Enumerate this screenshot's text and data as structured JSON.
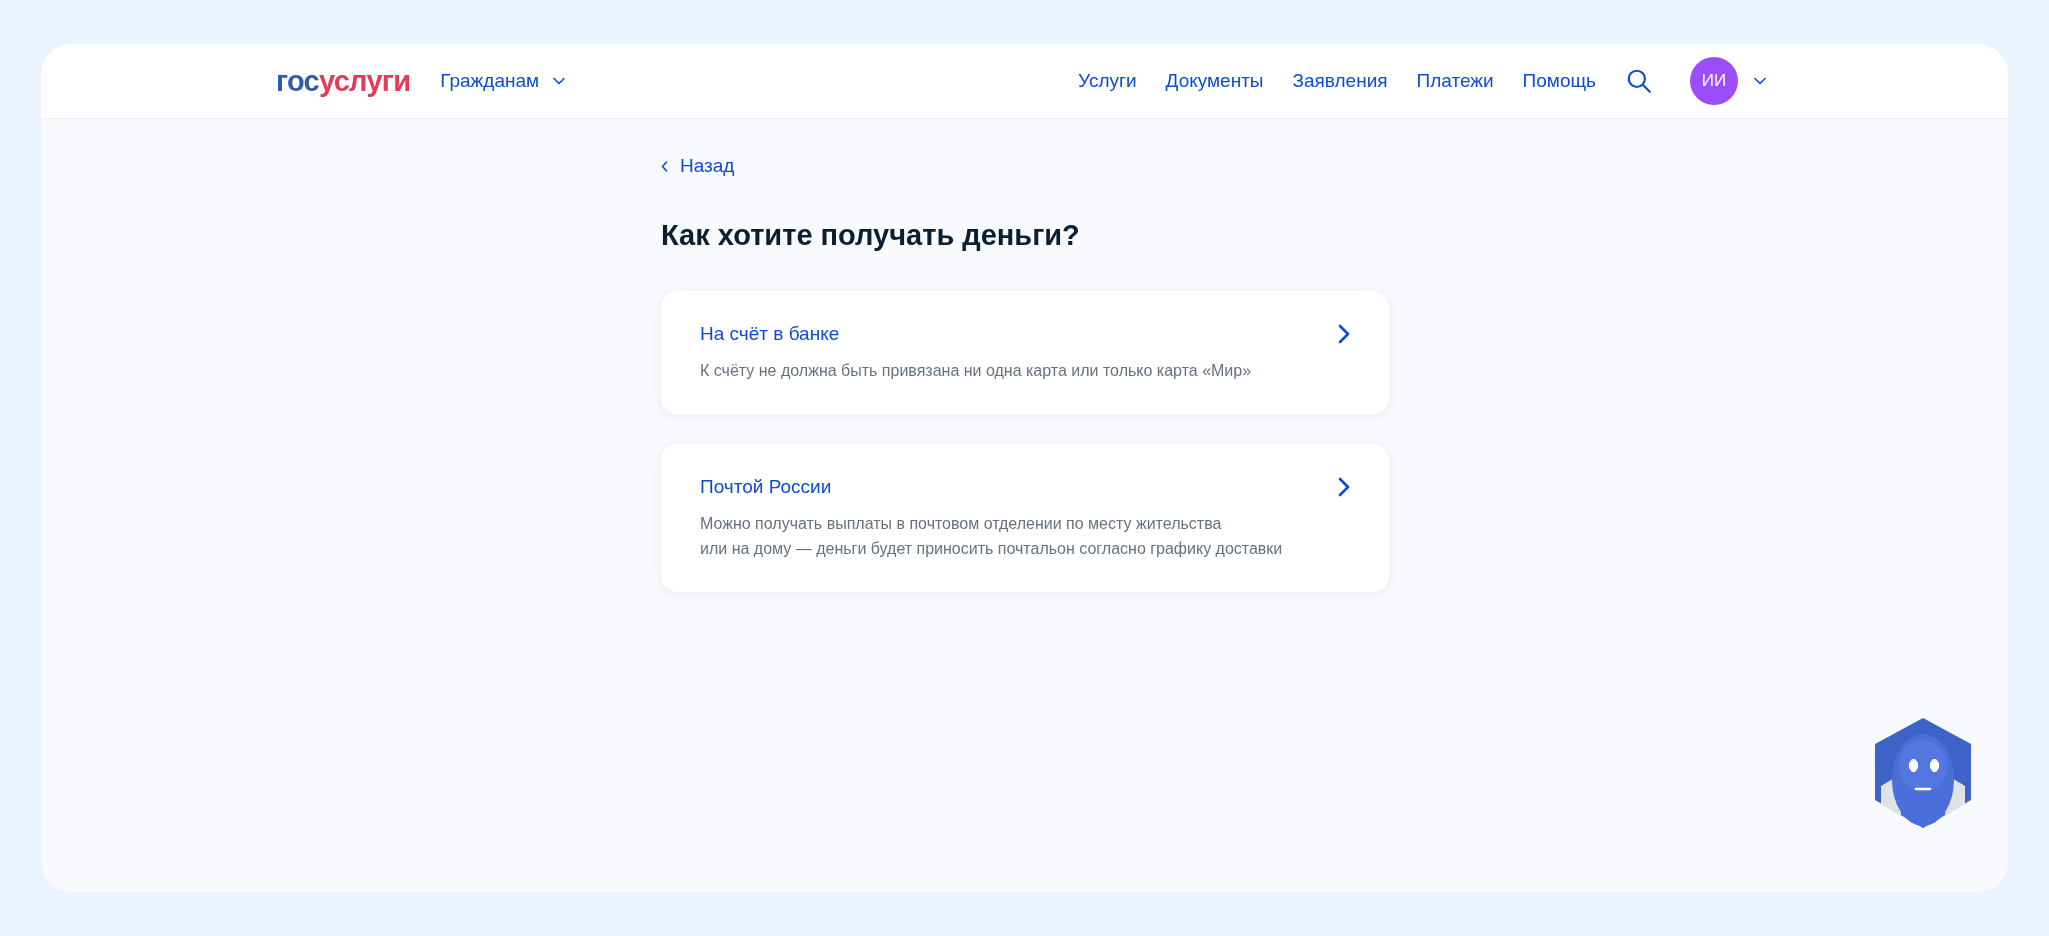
{
  "header": {
    "logo": {
      "prefix": "гос",
      "suffix": "услуги"
    },
    "audience": "Гражданам",
    "nav": [
      "Услуги",
      "Документы",
      "Заявления",
      "Платежи",
      "Помощь"
    ],
    "avatar": "ИИ"
  },
  "back": "Назад",
  "title": "Как хотите получать деньги?",
  "options": [
    {
      "title": "На счёт в банке",
      "description": [
        "К счёту не должна быть привязана ни одна карта или только карта «Мир»"
      ]
    },
    {
      "title": "Почтой России",
      "description": [
        "Можно получать выплаты в почтовом отделении по месту жительства",
        "или на дому — деньги будет приносить почтальон согласно графику доставки"
      ]
    }
  ]
}
